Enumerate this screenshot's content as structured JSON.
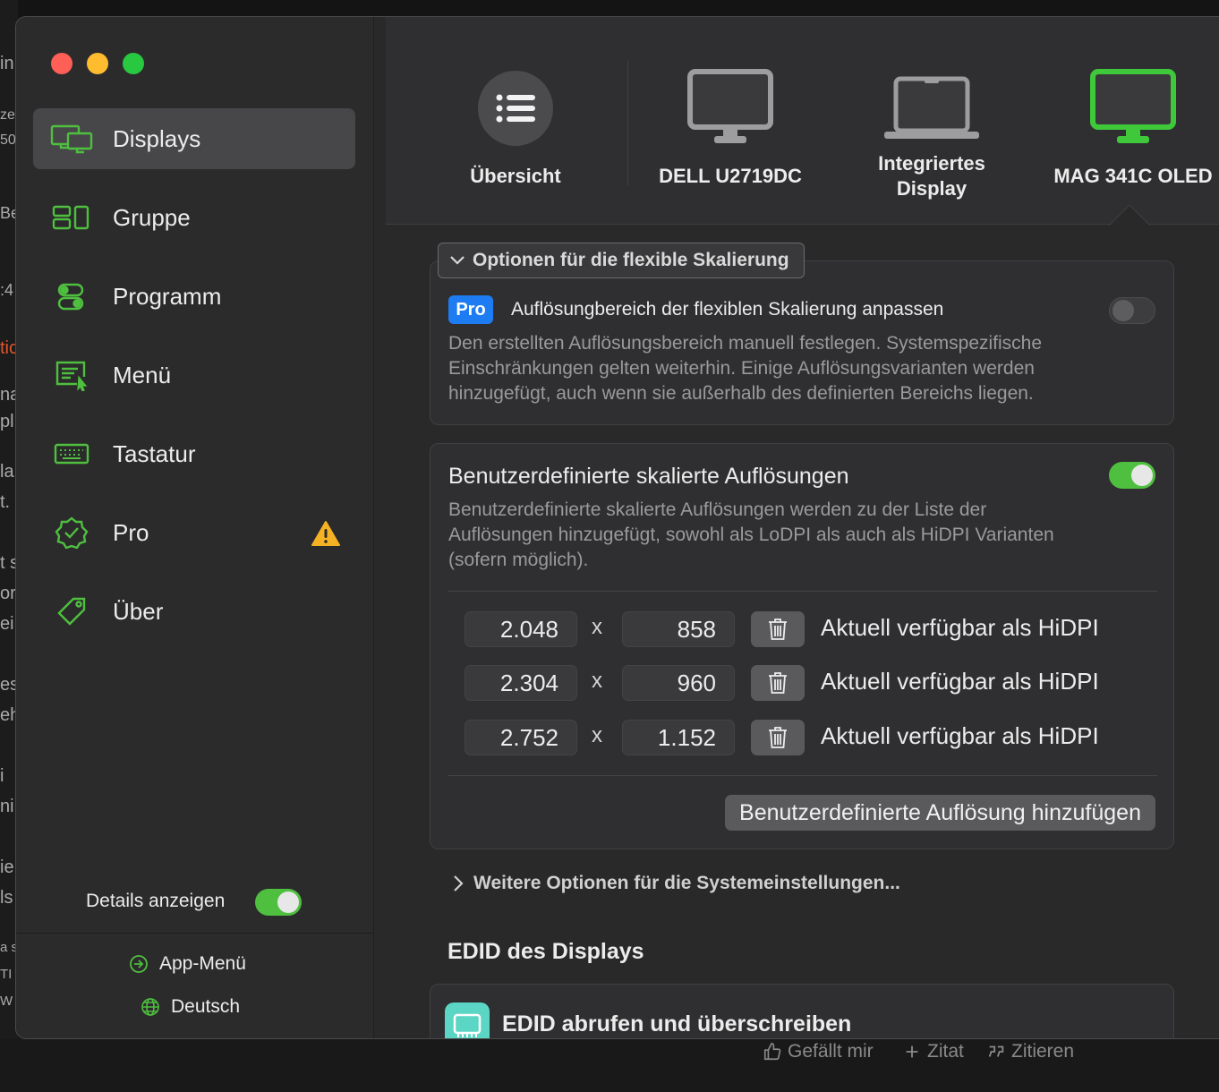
{
  "background": {
    "left_fragments": [
      "in",
      "ze",
      "50",
      "Be",
      ":4",
      "tic",
      "na",
      "pl",
      "la",
      "t.",
      "t s",
      "or",
      "ei",
      "es",
      "eh",
      "i",
      "ni",
      "ie",
      "ls",
      "a s",
      "TI",
      "W"
    ],
    "bottom_actions": [
      {
        "icon": "thumbs-up-icon",
        "label": "Gefällt mir"
      },
      {
        "icon": "plus-icon",
        "label": "Zitat"
      },
      {
        "icon": "quote-icon",
        "label": "Zitieren"
      }
    ]
  },
  "sidebar": {
    "items": [
      {
        "label": "Displays",
        "icon": "displays-icon",
        "active": true
      },
      {
        "label": "Gruppe",
        "icon": "group-icon"
      },
      {
        "label": "Programm",
        "icon": "toggles-icon"
      },
      {
        "label": "Menü",
        "icon": "menu-icon"
      },
      {
        "label": "Tastatur",
        "icon": "keyboard-icon"
      },
      {
        "label": "Pro",
        "icon": "badge-check-icon",
        "warning": true
      },
      {
        "label": "Über",
        "icon": "tag-icon"
      }
    ],
    "details_label": "Details anzeigen",
    "details_on": true,
    "footer": [
      {
        "label": "App-Menü",
        "icon": "arrow-circle-icon"
      },
      {
        "label": "Deutsch",
        "icon": "globe-icon"
      }
    ]
  },
  "tabs": [
    {
      "label": "Übersicht",
      "icon": "list-icon"
    },
    {
      "label": "DELL U2719DC",
      "icon": "monitor-icon"
    },
    {
      "label": "Integriertes Display",
      "label_line1": "Integriertes",
      "label_line2": "Display",
      "icon": "laptop-icon"
    },
    {
      "label": "MAG 341C OLED",
      "icon": "monitor-icon",
      "selected": true
    }
  ],
  "flex_scaling": {
    "disclosure_label": "Optionen für die flexible Skalierung",
    "pro_badge": "Pro",
    "title": "Auflösungbereich der flexiblen Skalierung anpassen",
    "toggle_on": false,
    "desc_lines": [
      "Den erstellten Auflösungsbereich manuell festlegen. Systemspezifische",
      "Einschränkungen gelten weiterhin. Einige Auflösungsvarianten werden",
      "hinzugefügt, auch wenn sie außerhalb des definierten Bereichs liegen."
    ]
  },
  "custom_res": {
    "title": "Benutzerdefinierte skalierte Auflösungen",
    "toggle_on": true,
    "desc_lines": [
      "Benutzerdefinierte skalierte Auflösungen werden zu der Liste der",
      "Auflösungen hinzugefügt, sowohl als LoDPI als auch als HiDPI Varianten",
      "(sofern möglich)."
    ],
    "separator": "x",
    "rows": [
      {
        "width": "2.048",
        "height": "858",
        "status": "Aktuell verfügbar als HiDPI"
      },
      {
        "width": "2.304",
        "height": "960",
        "status": "Aktuell verfügbar als HiDPI"
      },
      {
        "width": "2.752",
        "height": "1.152",
        "status": "Aktuell verfügbar als HiDPI"
      }
    ],
    "add_button": "Benutzerdefinierte Auflösung hinzufügen"
  },
  "more_options": "Weitere Optionen für die Systemeinstellungen...",
  "edid": {
    "section_title": "EDID des Displays",
    "card_title": "EDID abrufen und überschreiben"
  },
  "colors": {
    "accent_green": "#4fbf3f",
    "selected_monitor": "#3ec83a",
    "pro_blue": "#1e7cf2",
    "warning": "#f5b323"
  }
}
